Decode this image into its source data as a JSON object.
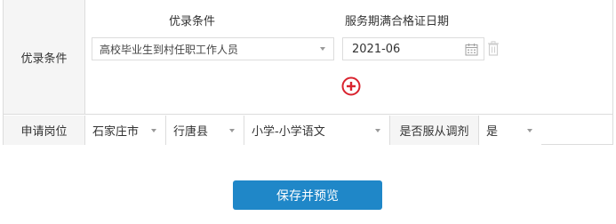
{
  "row1": {
    "label": "优录条件",
    "header_condition": "优录条件",
    "header_date": "服务期满合格证日期",
    "condition_select": "高校毕业生到村任职工作人员",
    "date_value": "2021-06"
  },
  "row2": {
    "label": "申请岗位",
    "city": "石家庄市",
    "county": "行唐县",
    "subject": "小学-小学语文",
    "adjust_label": "是否服从调剂",
    "adjust_value": "是"
  },
  "submit_label": "保存并预览",
  "colors": {
    "accent": "#1f87c8",
    "add_icon": "#d9232e",
    "border": "#dcdcdc",
    "label_bg": "#f5f5f5"
  },
  "icons": [
    "calendar-icon",
    "trash-icon",
    "add-circle-icon",
    "chevron-down-icon"
  ]
}
